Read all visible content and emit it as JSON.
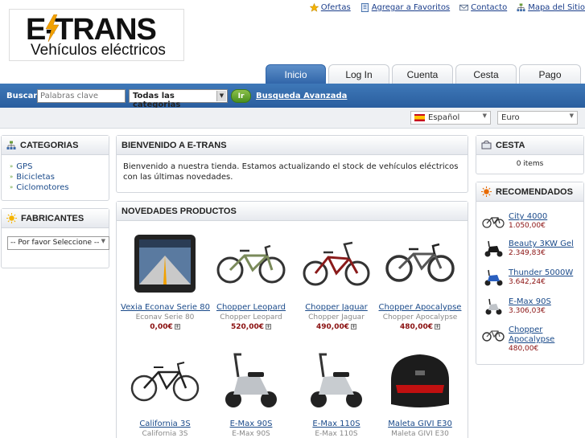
{
  "header": {
    "logo_title": "E-TRANS",
    "logo_subtitle": "Vehículos eléctricos",
    "links": [
      {
        "label": "Ofertas",
        "icon": "star-icon"
      },
      {
        "label": "Agregar a Favoritos",
        "icon": "bookmark-icon"
      },
      {
        "label": "Contacto",
        "icon": "mail-icon"
      },
      {
        "label": "Mapa del Sitio",
        "icon": "sitemap-icon"
      }
    ]
  },
  "tabs": [
    "Inicio",
    "Log In",
    "Cuenta",
    "Cesta",
    "Pago"
  ],
  "search": {
    "label": "Buscar:",
    "placeholder": "Palabras clave",
    "category": "Todas las categorias",
    "go_label": "Ir",
    "advanced": "Busqueda Avanzada"
  },
  "selectors": {
    "language": "Español",
    "currency": "Euro"
  },
  "categories": {
    "title": "CATEGORIAS",
    "items": [
      "GPS",
      "Bicicletas",
      "Ciclomotores"
    ]
  },
  "manufacturers": {
    "title": "FABRICANTES",
    "select": "-- Por favor Seleccione --"
  },
  "welcome": {
    "title": "BIENVENIDO A E-TRANS",
    "text": "Bienvenido a nuestra tienda. Estamos actualizando el stock de vehículos eléctricos con las últimas novedades."
  },
  "new_products": {
    "title": "NOVEDADES PRODUCTOS",
    "items": [
      {
        "name": "Vexia Econav Serie 80",
        "sub": "Econav Serie 80",
        "price": "0,00€"
      },
      {
        "name": "Chopper Leopard",
        "sub": "Chopper Leopard",
        "price": "520,00€"
      },
      {
        "name": "Chopper Jaguar",
        "sub": "Chopper Jaguar",
        "price": "490,00€"
      },
      {
        "name": "Chopper Apocalypse",
        "sub": "Chopper Apocalypse",
        "price": "480,00€"
      },
      {
        "name": "California 3S",
        "sub": "California 3S",
        "price": ""
      },
      {
        "name": "E-Max 90S",
        "sub": "E-Max 90S",
        "price": ""
      },
      {
        "name": "E-Max 110S",
        "sub": "E-Max 110S",
        "price": ""
      },
      {
        "name": "Maleta GIVI E30",
        "sub": "Maleta GIVI E30",
        "price": ""
      }
    ]
  },
  "cart": {
    "title": "CESTA",
    "text": "0 items"
  },
  "recommended": {
    "title": "RECOMENDADOS",
    "items": [
      {
        "name": "City 4000",
        "price": "1.050,00€"
      },
      {
        "name": "Beauty 3KW Gel",
        "price": "2.349,83€"
      },
      {
        "name": "Thunder 5000W",
        "price": "3.642,24€"
      },
      {
        "name": "E-Max 90S",
        "price": "3.306,03€"
      },
      {
        "name": "Chopper Apocalypse",
        "price": "480,00€"
      }
    ]
  },
  "colors": {
    "accent": "#2f64a8",
    "price": "#8a1010",
    "link": "#1a4a8a"
  }
}
